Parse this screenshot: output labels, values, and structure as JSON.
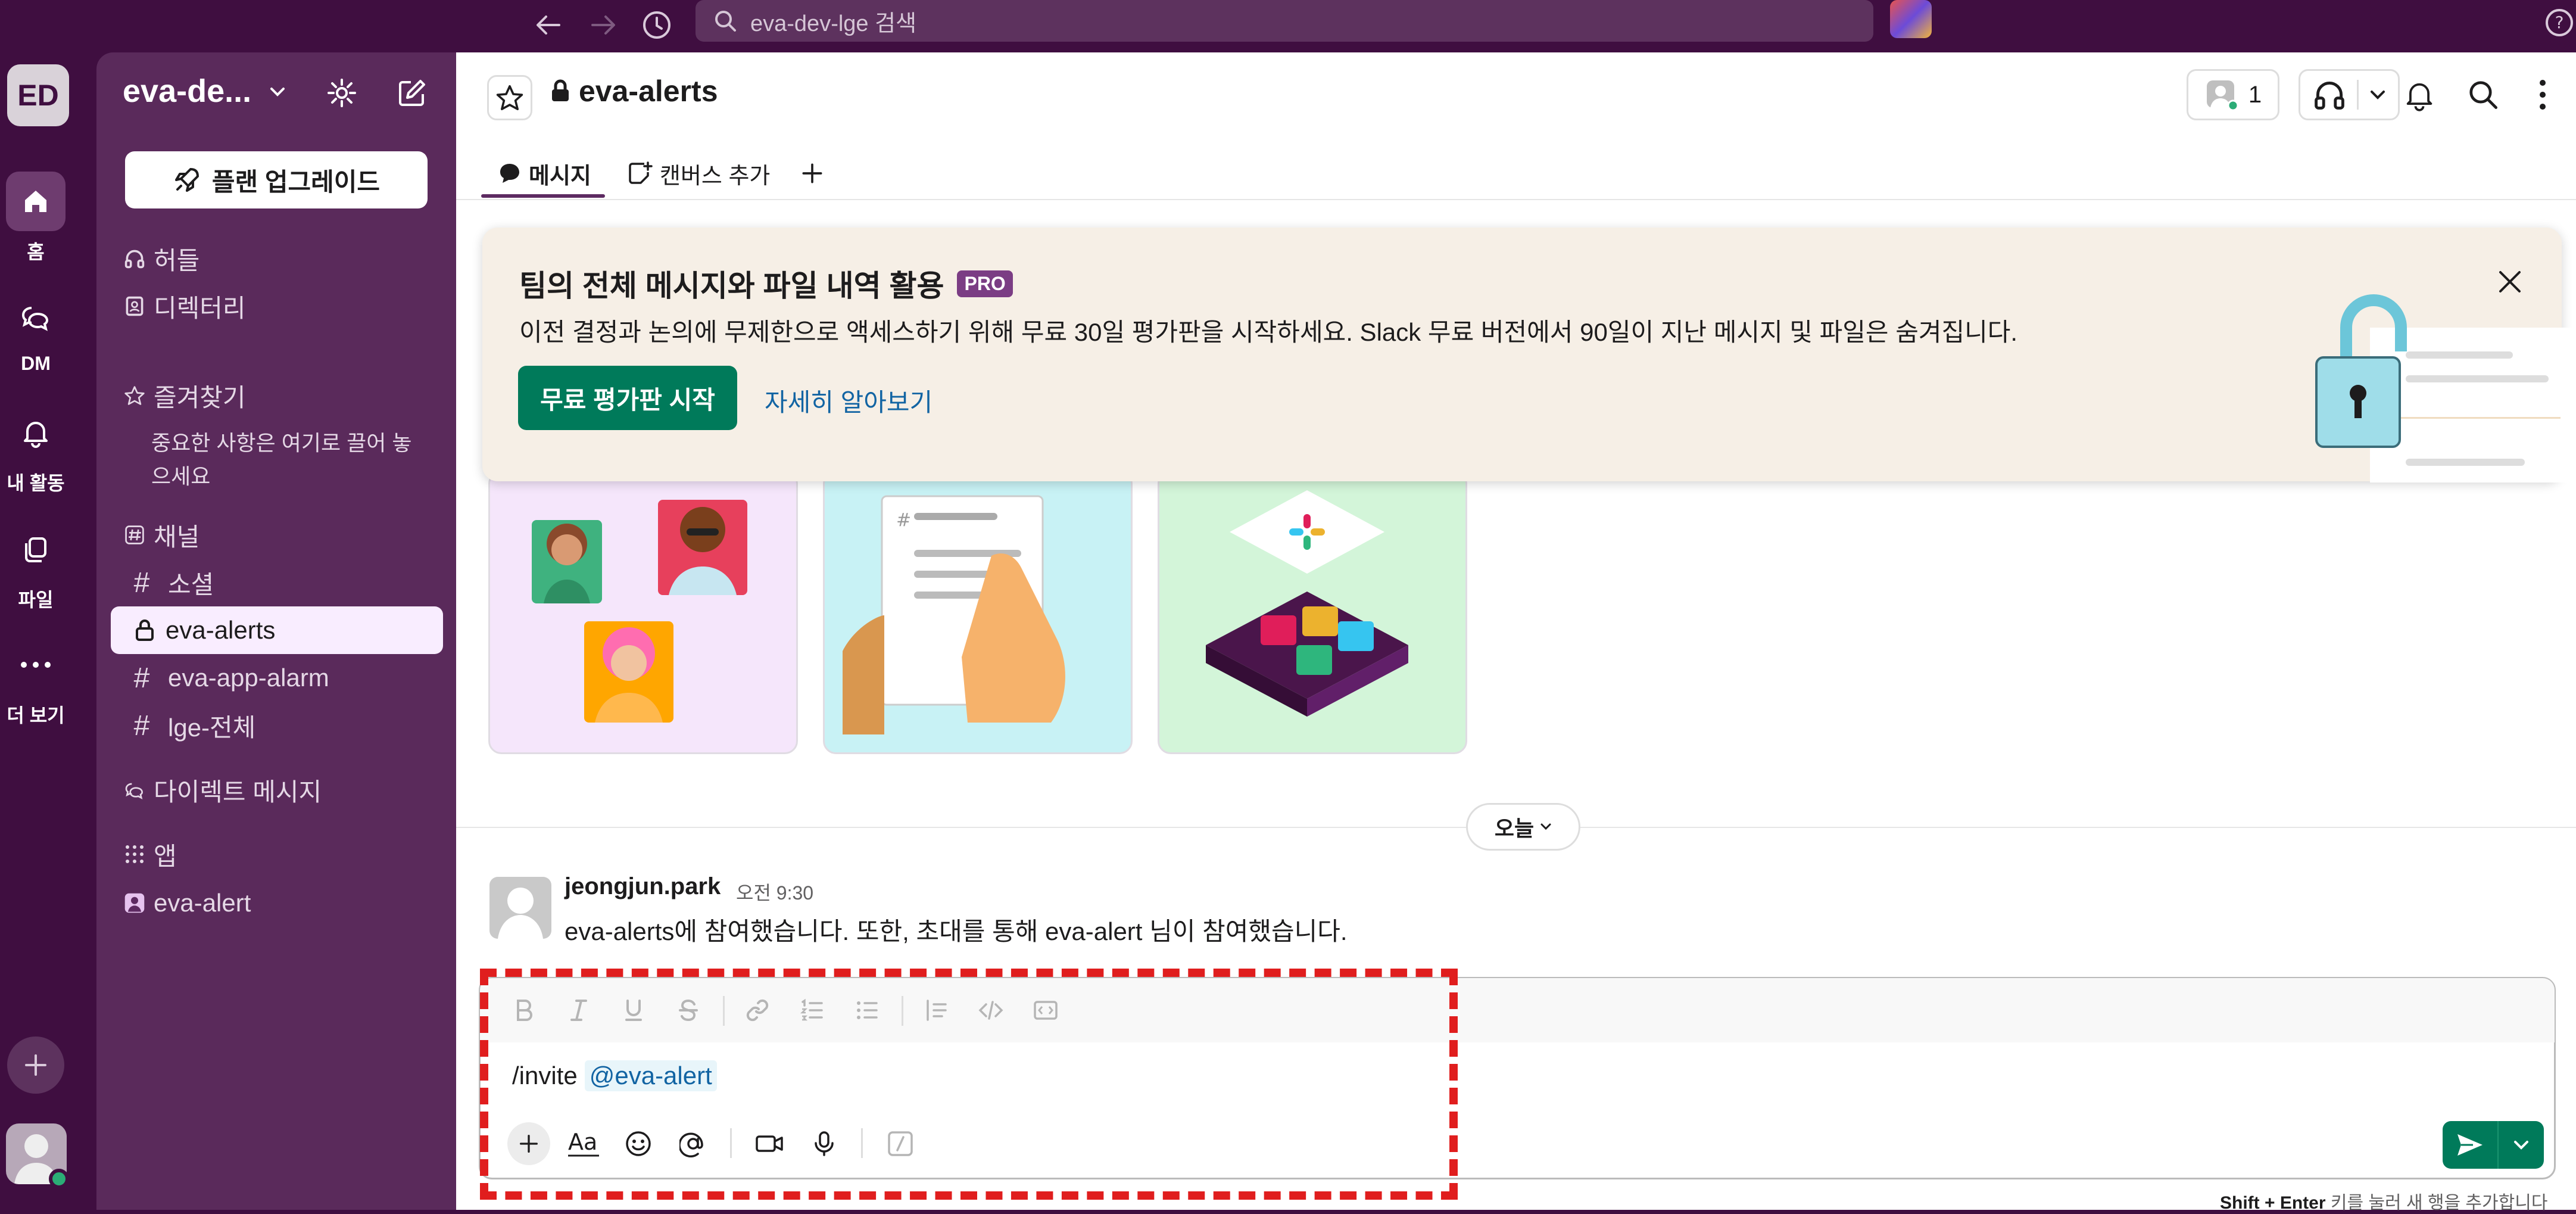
{
  "topbar": {
    "search_placeholder": "eva-dev-lge 검색"
  },
  "rail": {
    "workspace_initials": "ED",
    "items": [
      {
        "label": "홈",
        "icon": "home-icon"
      },
      {
        "label": "DM",
        "icon": "dm-icon"
      },
      {
        "label": "내 활동",
        "icon": "bell-icon"
      },
      {
        "label": "파일",
        "icon": "files-icon"
      },
      {
        "label": "더 보기",
        "icon": "more-icon"
      }
    ]
  },
  "sidebar": {
    "workspace_name": "eva-de...",
    "upgrade_label": "플랜 업그레이드",
    "huddles": "허들",
    "directory": "디렉터리",
    "favorites": "즐겨찾기",
    "favorites_hint": "중요한 사항은 여기로 끌어 놓으세요",
    "channels_header": "채널",
    "channels": [
      {
        "name": "소셜",
        "type": "public"
      },
      {
        "name": "eva-alerts",
        "type": "private",
        "active": true
      },
      {
        "name": "eva-app-alarm",
        "type": "public"
      },
      {
        "name": "lge-전체",
        "type": "public"
      }
    ],
    "dm_header": "다이렉트 메시지",
    "apps_header": "앱",
    "apps": [
      {
        "name": "eva-alert"
      }
    ]
  },
  "channel": {
    "name": "eva-alerts",
    "member_count": "1",
    "tabs": {
      "messages": "메시지",
      "canvas": "캔버스 추가"
    }
  },
  "banner": {
    "title": "팀의 전체 메시지와 파일 내역 활용",
    "badge": "PRO",
    "description": "이전 결정과 논의에 무제한으로 액세스하기 위해 무료 30일 평가판을 시작하세요. Slack 무료 버전에서 90일이 지난 메시지 및 파일은 숨겨집니다.",
    "primary_button": "무료 평가판 시작",
    "link": "자세히 알아보기"
  },
  "timeline": {
    "date_divider": "오늘",
    "messages": [
      {
        "author": "jeongjun.park",
        "time": "오전 9:30",
        "text": "eva-alerts에 참여했습니다. 또한, 초대를 통해 eva-alert 님이 참여했습니다."
      }
    ]
  },
  "composer": {
    "command": "/invite",
    "mention": "@eva-alert",
    "hint_key": "Shift + Enter",
    "hint_text": "키를 눌러 새 행을 추가합니다"
  },
  "colors": {
    "aubergine": "#3f0e40",
    "sidebar": "#5a2a5b",
    "primary_green": "#007a5a",
    "link_blue": "#1264a3",
    "highlight_red": "#e01e1e"
  }
}
